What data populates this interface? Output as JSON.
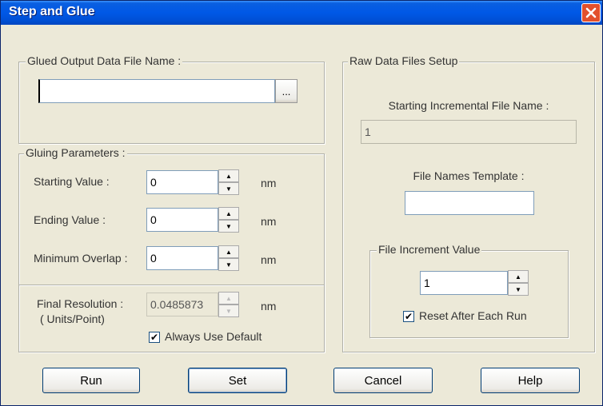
{
  "window": {
    "title": "Step and Glue"
  },
  "glued_output": {
    "legend": "Glued Output Data File Name :",
    "value": "",
    "browse_label": "..."
  },
  "gluing": {
    "legend": "Gluing Parameters :",
    "starting_label": "Starting Value :",
    "starting_value": "0",
    "ending_label": "Ending Value :",
    "ending_value": "0",
    "min_overlap_label": "Minimum Overlap :",
    "min_overlap_value": "0",
    "unit": "nm",
    "final_res_label": "Final Resolution :",
    "final_res_sub": "( Units/Point)",
    "final_res_value": "0.0485873",
    "always_default_label": "Always Use Default",
    "always_default_checked": true
  },
  "raw": {
    "legend": "Raw Data Files Setup",
    "start_file_label": "Starting Incremental File Name :",
    "start_file_value": "1",
    "template_label": "File Names Template :",
    "template_value": "",
    "increment_legend": "File Increment Value",
    "increment_value": "1",
    "reset_label": "Reset  After Each Run",
    "reset_checked": true
  },
  "buttons": {
    "run": "Run",
    "set": "Set",
    "cancel": "Cancel",
    "help": "Help"
  },
  "icons": {
    "close": "close-icon",
    "spin_up": "triangle-up-icon",
    "spin_down": "triangle-down-icon",
    "check": "checkmark-icon"
  },
  "colors": {
    "titlebar": "#0058e6",
    "close": "#e2502c",
    "dialog_bg": "#ece9d8"
  }
}
